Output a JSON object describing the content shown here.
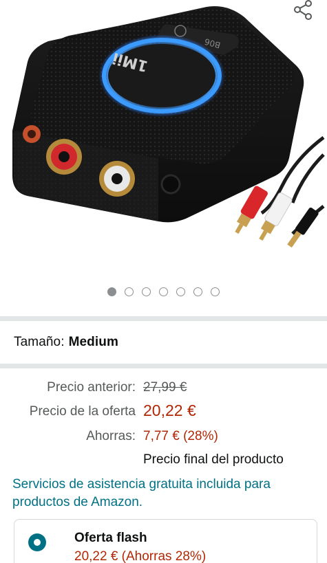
{
  "image": {
    "icon": "share-icon",
    "gallery": {
      "total": 7,
      "active_index": 0
    },
    "device_logo_text": "1Mii",
    "device_logo_subtext": "B06"
  },
  "size": {
    "label": "Tamaño:",
    "value": "Medium"
  },
  "pricing": {
    "previous_label": "Precio anterior:",
    "previous_value": "27,99 €",
    "deal_label": "Precio de la oferta",
    "deal_value": "20,22 €",
    "savings_label": "Ahorras:",
    "savings_value": "7,77 € (28%)",
    "final_note": "Precio final del producto"
  },
  "support_text": "Servicios de asistencia gratuita incluida para productos de Amazon.",
  "offer": {
    "title": "Oferta flash",
    "price": "20,22 € (Ahorras 28%)",
    "selected": true
  },
  "colors": {
    "link": "#007185",
    "price": "#b12704",
    "separator": "#e3e6e6",
    "device_ring": "#2f8cff"
  }
}
